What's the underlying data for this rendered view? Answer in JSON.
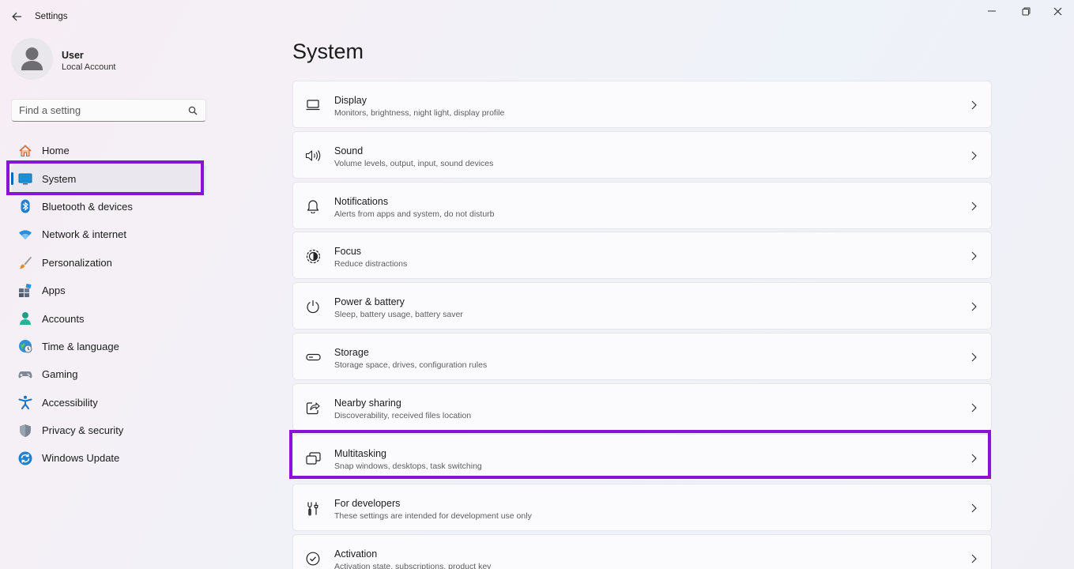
{
  "app": {
    "title": "Settings"
  },
  "user": {
    "name": "User",
    "account_type": "Local Account"
  },
  "search": {
    "placeholder": "Find a setting"
  },
  "sidebar": {
    "items": [
      {
        "label": "Home",
        "icon": "home-icon"
      },
      {
        "label": "System",
        "icon": "system-icon",
        "selected": true
      },
      {
        "label": "Bluetooth & devices",
        "icon": "bluetooth-icon"
      },
      {
        "label": "Network & internet",
        "icon": "network-icon"
      },
      {
        "label": "Personalization",
        "icon": "brush-icon"
      },
      {
        "label": "Apps",
        "icon": "apps-icon"
      },
      {
        "label": "Accounts",
        "icon": "accounts-icon"
      },
      {
        "label": "Time & language",
        "icon": "globe-clock-icon"
      },
      {
        "label": "Gaming",
        "icon": "gamepad-icon"
      },
      {
        "label": "Accessibility",
        "icon": "accessibility-icon"
      },
      {
        "label": "Privacy & security",
        "icon": "shield-icon"
      },
      {
        "label": "Windows Update",
        "icon": "update-icon"
      }
    ]
  },
  "main": {
    "title": "System",
    "cards": [
      {
        "title": "Display",
        "subtitle": "Monitors, brightness, night light, display profile",
        "icon": "display-icon"
      },
      {
        "title": "Sound",
        "subtitle": "Volume levels, output, input, sound devices",
        "icon": "speaker-icon"
      },
      {
        "title": "Notifications",
        "subtitle": "Alerts from apps and system, do not disturb",
        "icon": "bell-icon"
      },
      {
        "title": "Focus",
        "subtitle": "Reduce distractions",
        "icon": "focus-icon"
      },
      {
        "title": "Power & battery",
        "subtitle": "Sleep, battery usage, battery saver",
        "icon": "power-icon"
      },
      {
        "title": "Storage",
        "subtitle": "Storage space, drives, configuration rules",
        "icon": "storage-icon"
      },
      {
        "title": "Nearby sharing",
        "subtitle": "Discoverability, received files location",
        "icon": "share-icon"
      },
      {
        "title": "Multitasking",
        "subtitle": "Snap windows, desktops, task switching",
        "icon": "multitasking-icon"
      },
      {
        "title": "For developers",
        "subtitle": "These settings are intended for development use only",
        "icon": "developer-tools-icon"
      },
      {
        "title": "Activation",
        "subtitle": "Activation state, subscriptions, product key",
        "icon": "activation-icon"
      }
    ]
  },
  "colors": {
    "accent": "#0067c0",
    "highlight": "#8a12d8"
  }
}
